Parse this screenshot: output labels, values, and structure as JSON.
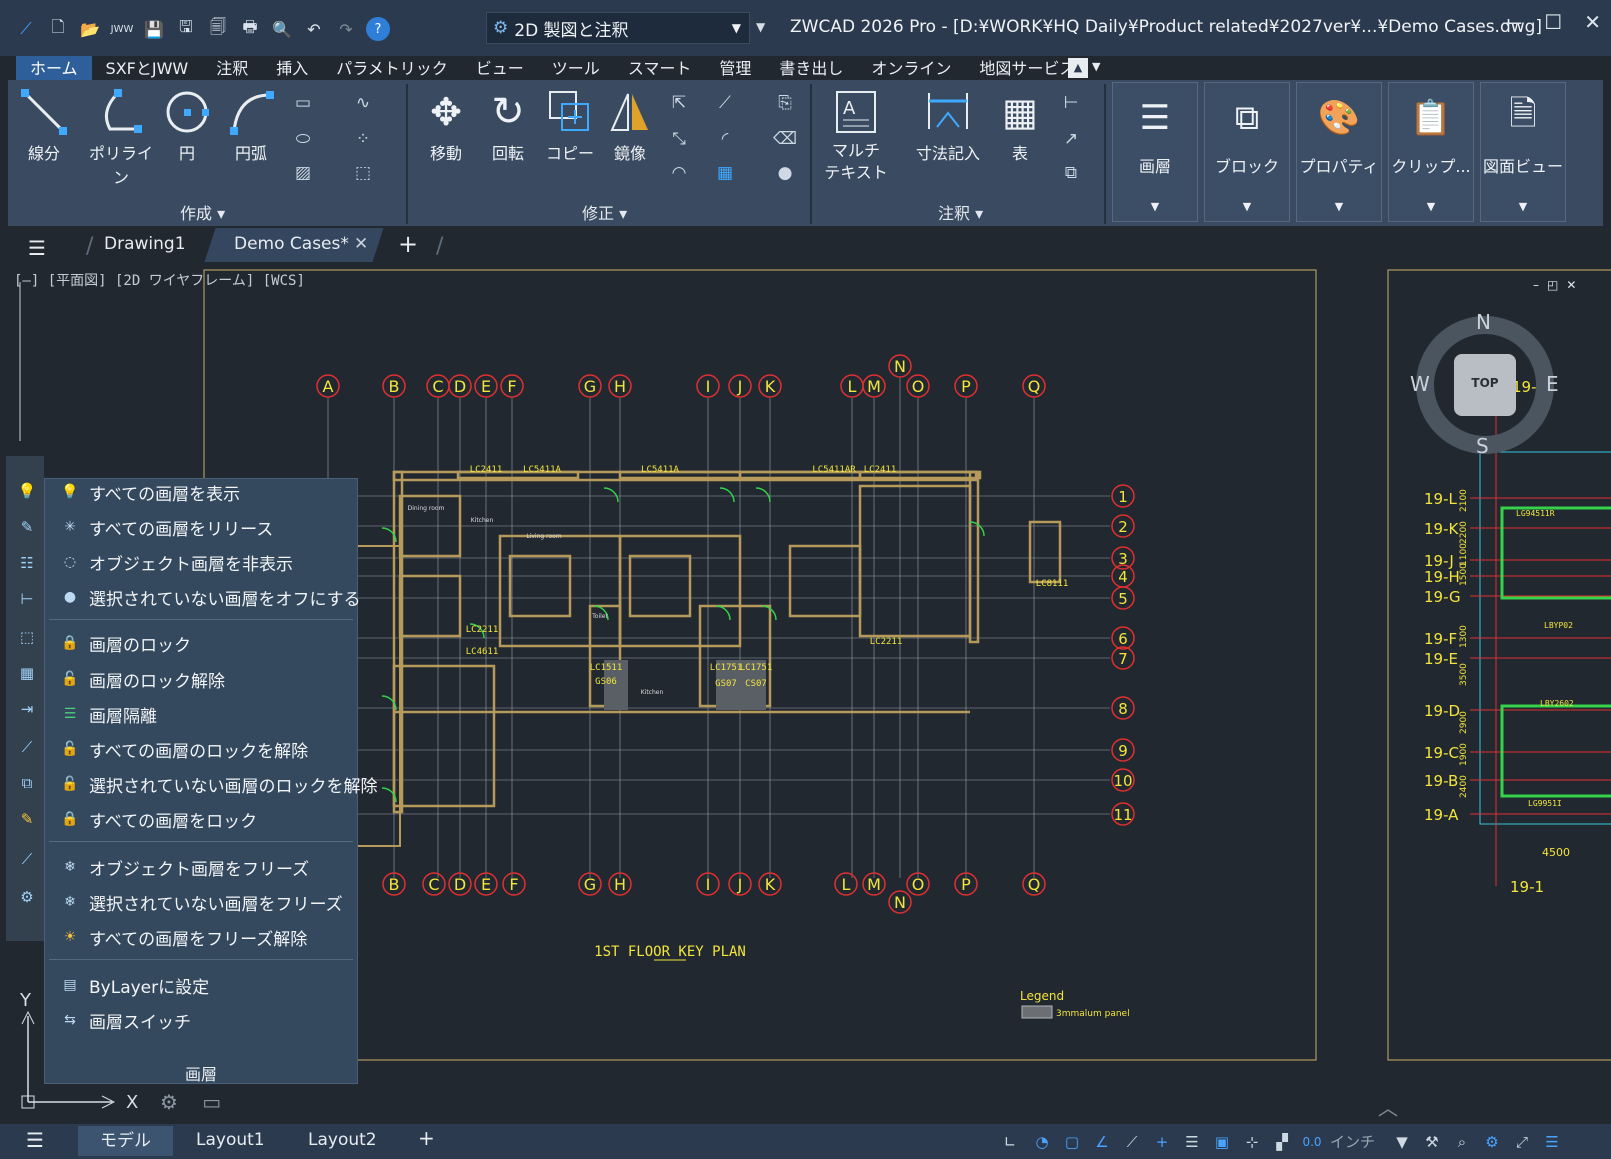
{
  "app": {
    "workspace": "2D 製図と注釈",
    "title": "ZWCAD 2026 Pro - [D:¥WORK¥HQ Daily¥Product related¥2027ver¥...¥Demo Cases.dwg]"
  },
  "menu_tabs": [
    "ホーム",
    "SXFとJWW",
    "注釈",
    "挿入",
    "パラメトリック",
    "ビュー",
    "ツール",
    "スマート",
    "管理",
    "書き出し",
    "オンライン",
    "地図サービス"
  ],
  "ribbon": {
    "create": {
      "title": "作成",
      "tools": [
        "線分",
        "ポリライン",
        "円",
        "円弧"
      ]
    },
    "modify": {
      "title": "修正",
      "tools": [
        "移動",
        "回転",
        "コピー",
        "鏡像"
      ]
    },
    "annotate": {
      "title": "注釈",
      "tools": [
        "マルチ\nテキスト",
        "寸法記入",
        "表"
      ]
    },
    "big_buttons": [
      "画層",
      "ブロック",
      "プロパティ",
      "クリップ...",
      "図面ビュー"
    ]
  },
  "doc_tabs": {
    "tabs": [
      "Drawing1",
      "Demo Cases*"
    ],
    "active": "Demo Cases*"
  },
  "viewport_label": "[–] [平面図] [2D ワイヤフレーム] [WCS]",
  "layer_flyout": {
    "title": "画層",
    "groups": [
      [
        "すべての画層を表示",
        "すべての画層をリリース",
        "オブジェクト画層を非表示",
        "選択されていない画層をオフにする"
      ],
      [
        "画層のロック",
        "画層のロック解除",
        "画層隔離",
        "すべての画層のロックを解除",
        "選択されていない画層のロックを解除",
        "すべての画層をロック"
      ],
      [
        "オブジェクト画層をフリーズ",
        "選択されていない画層をフリーズ",
        "すべての画層をフリーズ解除"
      ],
      [
        "ByLayerに設定",
        "画層スイッチ"
      ]
    ]
  },
  "drawing": {
    "grid_top": [
      "A",
      "B",
      "C",
      "D",
      "E",
      "F",
      "G",
      "H",
      "I",
      "J",
      "K",
      "L",
      "M",
      "N",
      "O",
      "P",
      "Q"
    ],
    "grid_bottom": [
      "B",
      "C",
      "D",
      "E",
      "F",
      "G",
      "H",
      "I",
      "J",
      "K",
      "L",
      "M",
      "N",
      "O",
      "P",
      "Q"
    ],
    "grid_right": [
      "1",
      "2",
      "3",
      "4",
      "5",
      "6",
      "7",
      "8",
      "9",
      "10",
      "11"
    ],
    "key_plan_title": "1ST FLOOR KEY PLAN",
    "legend_title": "Legend",
    "legend_item": "3mmalum panel",
    "labels": [
      "LC2411",
      "LC5411A",
      "LC5411A",
      "LC5411AR",
      "LC2411",
      "LC8111",
      "LC2211",
      "LC4611",
      "LC1511",
      "GS06",
      "LC1751",
      "LC1751",
      "GS07",
      "CS07",
      "LC2211"
    ],
    "room_labels": [
      "Dining room",
      "Kitchen",
      "Living room",
      "Toilet",
      "Kitchen"
    ],
    "side_labels": [
      "19-1",
      "19-L",
      "19-K",
      "19-J",
      "19-H",
      "19-G",
      "19-F",
      "19-E",
      "19-D",
      "19-C",
      "19-B",
      "19-A",
      "19-1"
    ],
    "side_dims": [
      "2100",
      "2200",
      "1100",
      "1500",
      "1300",
      "3500",
      "2900",
      "1900",
      "2400",
      "4500"
    ],
    "side_tags": [
      "LG94511R",
      "LBYP02",
      "LBY2602",
      "LG9951I"
    ]
  },
  "navcube": {
    "n": "N",
    "s": "S",
    "e": "E",
    "w": "W",
    "face": "TOP"
  },
  "ucs": {
    "x": "X",
    "y": "Y"
  },
  "status": {
    "tabs": [
      "モデル",
      "Layout1",
      "Layout2"
    ],
    "active_tab": "モデル",
    "units": "インチ"
  }
}
